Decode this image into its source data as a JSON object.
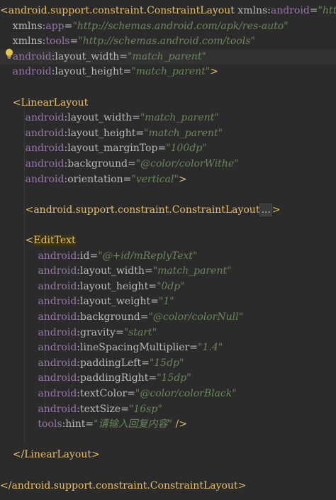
{
  "colors": {
    "background": "#2b2b2b",
    "tag": "#e8bf6a",
    "attribute": "#bababa",
    "namespace": "#9876aa",
    "string": "#6a8759",
    "current_line": "#323232"
  },
  "lines": [
    {
      "tokens": [
        {
          "t": "tag",
          "v": "<android.support.constraint.ConstraintLayout"
        },
        {
          "t": "attr",
          "v": " xmlns"
        },
        {
          "t": "colon",
          "v": ":"
        },
        {
          "t": "ns",
          "v": "android"
        },
        {
          "t": "eq",
          "v": "="
        },
        {
          "t": "val",
          "v": "\"http"
        }
      ]
    },
    {
      "tokens": [
        {
          "t": "attr",
          "v": "    xmlns"
        },
        {
          "t": "colon",
          "v": ":"
        },
        {
          "t": "ns",
          "v": "app"
        },
        {
          "t": "eq",
          "v": "="
        },
        {
          "t": "val",
          "v": "\"http://schemas.android.com/apk/res-auto\""
        }
      ]
    },
    {
      "tokens": [
        {
          "t": "attr",
          "v": "    xmlns"
        },
        {
          "t": "colon",
          "v": ":"
        },
        {
          "t": "ns",
          "v": "tools"
        },
        {
          "t": "eq",
          "v": "="
        },
        {
          "t": "val",
          "v": "\"http://schemas.android.com/tools\""
        }
      ]
    },
    {
      "current": true,
      "tokens": [
        {
          "t": "ns",
          "v": "    android"
        },
        {
          "t": "colon",
          "v": ":"
        },
        {
          "t": "attr",
          "v": "layout_width"
        },
        {
          "t": "eq",
          "v": "="
        },
        {
          "t": "val",
          "v": "\"match_parent\""
        }
      ]
    },
    {
      "tokens": [
        {
          "t": "ns",
          "v": "    android"
        },
        {
          "t": "colon",
          "v": ":"
        },
        {
          "t": "attr",
          "v": "layout_height"
        },
        {
          "t": "eq",
          "v": "="
        },
        {
          "t": "val",
          "v": "\"match_parent\""
        },
        {
          "t": "tag",
          "v": ">"
        }
      ]
    },
    {
      "tokens": []
    },
    {
      "tokens": [
        {
          "t": "tag",
          "v": "    <LinearLayout"
        }
      ]
    },
    {
      "tokens": [
        {
          "t": "ns",
          "v": "        android"
        },
        {
          "t": "colon",
          "v": ":"
        },
        {
          "t": "attr",
          "v": "layout_width"
        },
        {
          "t": "eq",
          "v": "="
        },
        {
          "t": "val",
          "v": "\"match_parent\""
        }
      ]
    },
    {
      "tokens": [
        {
          "t": "ns",
          "v": "        android"
        },
        {
          "t": "colon",
          "v": ":"
        },
        {
          "t": "attr",
          "v": "layout_height"
        },
        {
          "t": "eq",
          "v": "="
        },
        {
          "t": "val",
          "v": "\"match_parent\""
        }
      ]
    },
    {
      "tokens": [
        {
          "t": "ns",
          "v": "        android"
        },
        {
          "t": "colon",
          "v": ":"
        },
        {
          "t": "attr",
          "v": "layout_marginTop"
        },
        {
          "t": "eq",
          "v": "="
        },
        {
          "t": "val",
          "v": "\"100dp\""
        }
      ]
    },
    {
      "tokens": [
        {
          "t": "ns",
          "v": "        android"
        },
        {
          "t": "colon",
          "v": ":"
        },
        {
          "t": "attr",
          "v": "background"
        },
        {
          "t": "eq",
          "v": "="
        },
        {
          "t": "val",
          "v": "\"@color/colorWithe\""
        }
      ]
    },
    {
      "tokens": [
        {
          "t": "ns",
          "v": "        android"
        },
        {
          "t": "colon",
          "v": ":"
        },
        {
          "t": "attr",
          "v": "orientation"
        },
        {
          "t": "eq",
          "v": "="
        },
        {
          "t": "val",
          "v": "\"vertical\""
        },
        {
          "t": "tag",
          "v": ">"
        }
      ]
    },
    {
      "tokens": []
    },
    {
      "tokens": [
        {
          "t": "tag",
          "v": "        <android.support.constraint.ConstraintLayout"
        },
        {
          "t": "ellip",
          "v": "..."
        },
        {
          "t": "tag",
          "v": ">"
        }
      ]
    },
    {
      "tokens": []
    },
    {
      "tokens": [
        {
          "t": "tag",
          "v": "        <"
        },
        {
          "t": "taghl",
          "v": "EditText"
        }
      ]
    },
    {
      "tokens": [
        {
          "t": "ns",
          "v": "            android"
        },
        {
          "t": "colon",
          "v": ":"
        },
        {
          "t": "attr",
          "v": "id"
        },
        {
          "t": "eq",
          "v": "="
        },
        {
          "t": "val",
          "v": "\"@+id/mReplyText\""
        }
      ]
    },
    {
      "tokens": [
        {
          "t": "ns",
          "v": "            android"
        },
        {
          "t": "colon",
          "v": ":"
        },
        {
          "t": "attr",
          "v": "layout_width"
        },
        {
          "t": "eq",
          "v": "="
        },
        {
          "t": "val",
          "v": "\"match_parent\""
        }
      ]
    },
    {
      "tokens": [
        {
          "t": "ns",
          "v": "            android"
        },
        {
          "t": "colon",
          "v": ":"
        },
        {
          "t": "attr",
          "v": "layout_height"
        },
        {
          "t": "eq",
          "v": "="
        },
        {
          "t": "val",
          "v": "\"0dp\""
        }
      ]
    },
    {
      "tokens": [
        {
          "t": "ns",
          "v": "            android"
        },
        {
          "t": "colon",
          "v": ":"
        },
        {
          "t": "attr",
          "v": "layout_weight"
        },
        {
          "t": "eq",
          "v": "="
        },
        {
          "t": "val",
          "v": "\"1\""
        }
      ]
    },
    {
      "tokens": [
        {
          "t": "ns",
          "v": "            android"
        },
        {
          "t": "colon",
          "v": ":"
        },
        {
          "t": "attr",
          "v": "background"
        },
        {
          "t": "eq",
          "v": "="
        },
        {
          "t": "val",
          "v": "\"@color/colorNull\""
        }
      ]
    },
    {
      "tokens": [
        {
          "t": "ns",
          "v": "            android"
        },
        {
          "t": "colon",
          "v": ":"
        },
        {
          "t": "attr",
          "v": "gravity"
        },
        {
          "t": "eq",
          "v": "="
        },
        {
          "t": "val",
          "v": "\"start\""
        }
      ]
    },
    {
      "tokens": [
        {
          "t": "ns",
          "v": "            android"
        },
        {
          "t": "colon",
          "v": ":"
        },
        {
          "t": "attr",
          "v": "lineSpacingMultiplier"
        },
        {
          "t": "eq",
          "v": "="
        },
        {
          "t": "val",
          "v": "\"1.4\""
        }
      ]
    },
    {
      "tokens": [
        {
          "t": "ns",
          "v": "            android"
        },
        {
          "t": "colon",
          "v": ":"
        },
        {
          "t": "attr",
          "v": "paddingLeft"
        },
        {
          "t": "eq",
          "v": "="
        },
        {
          "t": "val",
          "v": "\"15dp\""
        }
      ]
    },
    {
      "tokens": [
        {
          "t": "ns",
          "v": "            android"
        },
        {
          "t": "colon",
          "v": ":"
        },
        {
          "t": "attr",
          "v": "paddingRight"
        },
        {
          "t": "eq",
          "v": "="
        },
        {
          "t": "val",
          "v": "\"15dp\""
        }
      ]
    },
    {
      "tokens": [
        {
          "t": "ns",
          "v": "            android"
        },
        {
          "t": "colon",
          "v": ":"
        },
        {
          "t": "attr",
          "v": "textColor"
        },
        {
          "t": "eq",
          "v": "="
        },
        {
          "t": "val",
          "v": "\"@color/colorBlack\""
        }
      ]
    },
    {
      "tokens": [
        {
          "t": "ns",
          "v": "            android"
        },
        {
          "t": "colon",
          "v": ":"
        },
        {
          "t": "attr",
          "v": "textSize"
        },
        {
          "t": "eq",
          "v": "="
        },
        {
          "t": "val",
          "v": "\"16sp\""
        }
      ]
    },
    {
      "tokens": [
        {
          "t": "ns",
          "v": "            tools"
        },
        {
          "t": "colon",
          "v": ":"
        },
        {
          "t": "attr",
          "v": "hint"
        },
        {
          "t": "eq",
          "v": "="
        },
        {
          "t": "val",
          "v": "\"请输入回复内容\""
        },
        {
          "t": "tag",
          "v": " />"
        }
      ]
    },
    {
      "tokens": []
    },
    {
      "tokens": [
        {
          "t": "tag",
          "v": "    </LinearLayout>"
        }
      ]
    },
    {
      "tokens": []
    },
    {
      "tokens": [
        {
          "t": "tag",
          "v": "</android.support.constraint.ConstraintLayout>"
        }
      ]
    }
  ],
  "gutter_icon": "lightbulb-icon"
}
